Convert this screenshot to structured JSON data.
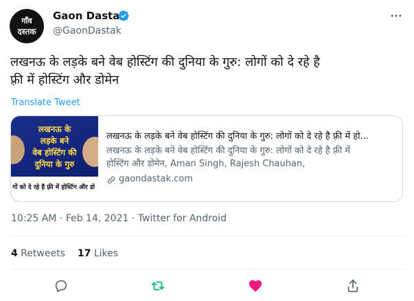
{
  "author": {
    "display_name": "Gaon Dastak",
    "handle": "@GaonDastak",
    "avatar_line1": "गाँव",
    "avatar_line2": "दस्तक"
  },
  "tweet": {
    "text_line1": "लखनऊ के लड़के बने वेब होस्टिंग की दुनिया के गुरु: लोगों को दे रहे है",
    "text_line2": "फ़्री में होस्टिंग और डोमेन",
    "translate_label": "Translate Tweet"
  },
  "card": {
    "thumb_line1": "लखनऊ के",
    "thumb_line2": "लड़के बने",
    "thumb_line3": "वेब होस्टिंग की",
    "thumb_line4": "दुनिया के गुरु",
    "thumb_bottom": "गों को दे रहे है फ़्री में होस्टिंग और डो",
    "title": "लखनऊ के लड़के बने वेब होस्टिंग की दुनिया के गुरु: लोगों को दे रहे है फ़्री में हो...",
    "description_line1": "लखनऊ के लड़के बने वेब होस्टिंग की दुनिया के गुरु: लोगों को दे रहे है फ़्री में",
    "description_line2": "होस्टिंग और डोमेन, Aman Singh, Rajesh Chauhan,",
    "domain": "gaondastak.com"
  },
  "meta": {
    "time": "10:25 AM",
    "separator": " · ",
    "date": "Feb 14, 2021",
    "source": "Twitter for Android"
  },
  "stats": {
    "retweets_count": "4",
    "retweets_label": "Retweets",
    "likes_count": "17",
    "likes_label": "Likes"
  },
  "colors": {
    "accent": "#1d9bf0",
    "retweet_green": "#00ba7c",
    "like_pink": "#f91880",
    "secondary_text": "#536471"
  },
  "icons": {
    "verified": "verified-badge-icon",
    "more": "more-horizontal-icon",
    "reply": "reply-icon",
    "retweet": "retweet-icon",
    "like": "heart-icon",
    "share": "share-icon",
    "link": "link-icon"
  }
}
